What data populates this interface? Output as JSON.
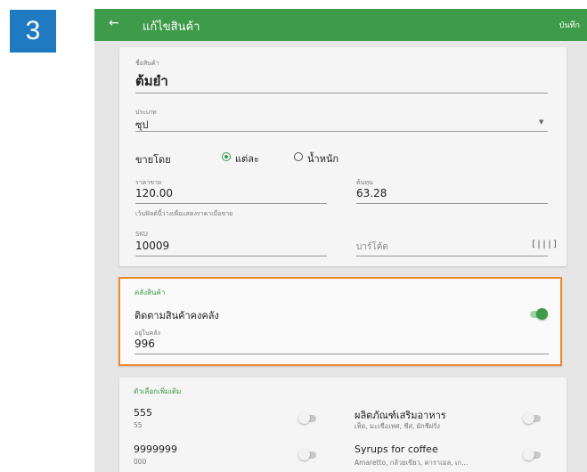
{
  "step_number": "3",
  "appbar": {
    "back_icon": "arrow-left-icon",
    "title": "แก้ไขสินค้า",
    "save_label": "บันทึก"
  },
  "product": {
    "name_label": "ชื่อสินค้า",
    "name_value": "ต้มยำ",
    "category_label": "ประเภท",
    "category_value": "ซุป",
    "sell_by_label": "ขายโดย",
    "sell_by_options": [
      "แต่ละ",
      "น้ำหนัก"
    ],
    "sell_by_selected": "แต่ละ",
    "price_label": "ราคาขาย",
    "price_value": "120.00",
    "price_hint": "เว้นฟิลด์นี้ว่างเพื่อแสดงราคาเมื่อขาย",
    "cost_label": "ต้นทุน",
    "cost_value": "63.28",
    "sku_label": "SKU",
    "sku_value": "10009",
    "barcode_placeholder": "บาร์โค้ด"
  },
  "inventory": {
    "section_label": "คลังสินค้า",
    "track_label": "ติดตามสินค้าคงคลัง",
    "track_enabled": true,
    "in_stock_label": "อยู่ในคลัง",
    "in_stock_value": "996"
  },
  "modifiers": {
    "section_label": "ตัวเลือกเพิ่มเติม",
    "items": [
      {
        "name": "555",
        "sub": "55",
        "enabled": false
      },
      {
        "name": "ผลิตภัณฑ์เสริมอาหาร",
        "sub": "เห็ด, มะเขือเทศ, ชีส, ผักชีฝรั่ง",
        "enabled": false
      },
      {
        "name": "9999999",
        "sub": "000",
        "enabled": false
      },
      {
        "name": "Syrups for coffee",
        "sub": "Amaretto, กล้วยเขียว, คาราเมล, เก...",
        "enabled": false
      }
    ]
  },
  "colors": {
    "primary": "#3e9b49",
    "highlight": "#ef8a2e",
    "badge": "#1f7ac2"
  }
}
